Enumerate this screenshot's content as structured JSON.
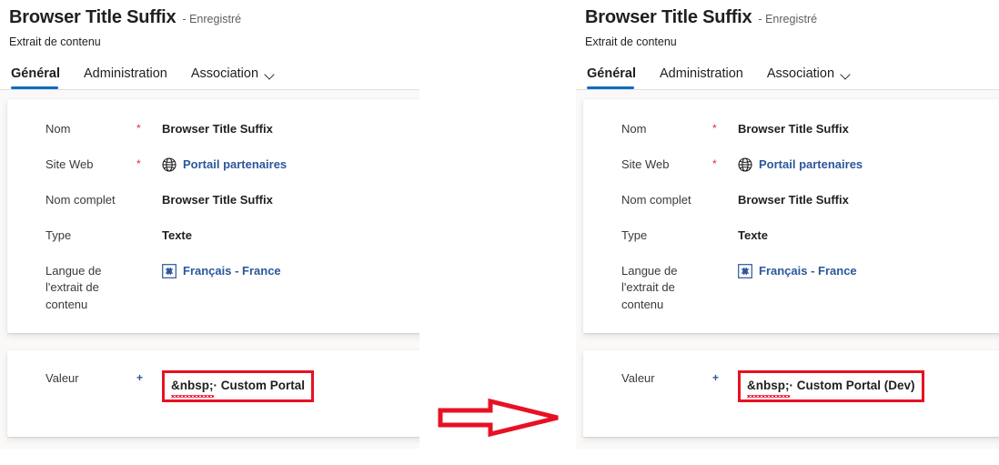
{
  "colors": {
    "accent": "#0f6cbd",
    "link": "#2b579a",
    "required": "#d13438",
    "highlight_box": "#e81123",
    "body_bg": "#faf9f8",
    "card_bg": "#ffffff",
    "text": "#201f1e",
    "muted_text": "#605e5c"
  },
  "header": {
    "title": "Browser Title Suffix",
    "status": "- Enregistré",
    "subtitle": "Extrait de contenu"
  },
  "tabs": [
    {
      "label": "Général",
      "active": true,
      "has_chevron": false
    },
    {
      "label": "Administration",
      "active": false,
      "has_chevron": false
    },
    {
      "label": "Association",
      "active": false,
      "has_chevron": true
    }
  ],
  "form": {
    "fields": [
      {
        "label": "Nom",
        "required_marker": "*",
        "required_kind": "star",
        "value": "Browser Title Suffix",
        "kind": "text",
        "icon": null
      },
      {
        "label": "Site Web",
        "required_marker": "*",
        "required_kind": "star",
        "value": "Portail partenaires",
        "kind": "link",
        "icon": "globe-icon"
      },
      {
        "label": "Nom complet",
        "required_marker": "",
        "required_kind": "none",
        "value": "Browser Title Suffix",
        "kind": "text",
        "icon": null
      },
      {
        "label": "Type",
        "required_marker": "",
        "required_kind": "none",
        "value": "Texte",
        "kind": "text",
        "icon": null
      },
      {
        "label": "Langue de l'extrait de contenu",
        "required_marker": "",
        "required_kind": "none",
        "value": "Français - France",
        "kind": "link",
        "icon": "language-icon"
      }
    ]
  },
  "value_card": {
    "label": "Valeur",
    "required_marker": "+",
    "required_kind": "plus",
    "left_value_misspelled": "&nbsp;",
    "left_value_rest": "· Custom Portal",
    "right_value_misspelled": "&nbsp;",
    "right_value_rest": "· Custom Portal (Dev)"
  },
  "annotation": {
    "arrow_name": "right-arrow",
    "arrow_color": "#e81123"
  }
}
